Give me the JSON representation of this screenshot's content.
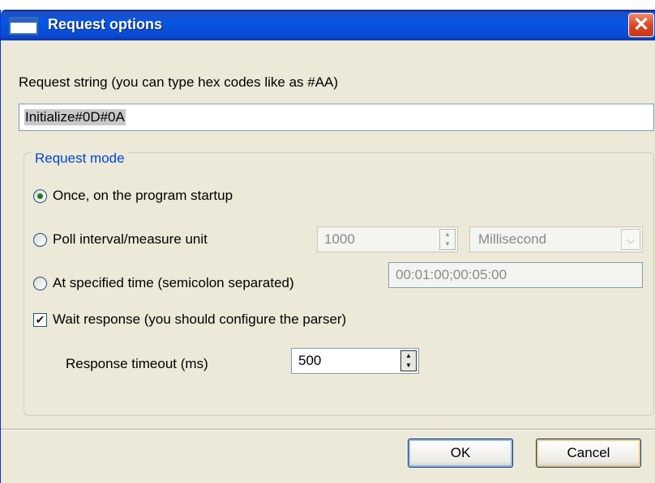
{
  "window": {
    "title": "Request options",
    "close_glyph": "✕"
  },
  "request": {
    "label": "Request string (you can type hex codes like as #AA)",
    "value": "Initialize#0D#0A"
  },
  "mode_group": {
    "title": "Request mode",
    "once_label": "Once, on the program startup",
    "once_checked": true,
    "poll_label": "Poll interval/measure unit",
    "poll_checked": false,
    "poll_value": "1000",
    "poll_unit": "Millisecond",
    "time_label": "At specified time (semicolon separated)",
    "time_checked": false,
    "time_value": "00:01:00;00:05:00",
    "wait_label": "Wait response (you should configure the parser)",
    "wait_checked": true,
    "timeout_label": "Response timeout (ms)",
    "timeout_value": "500"
  },
  "buttons": {
    "ok": "OK",
    "cancel": "Cancel"
  },
  "icons": {
    "spin_up": "▲",
    "spin_down": "▼",
    "drop": "⌵",
    "check": "✔"
  }
}
